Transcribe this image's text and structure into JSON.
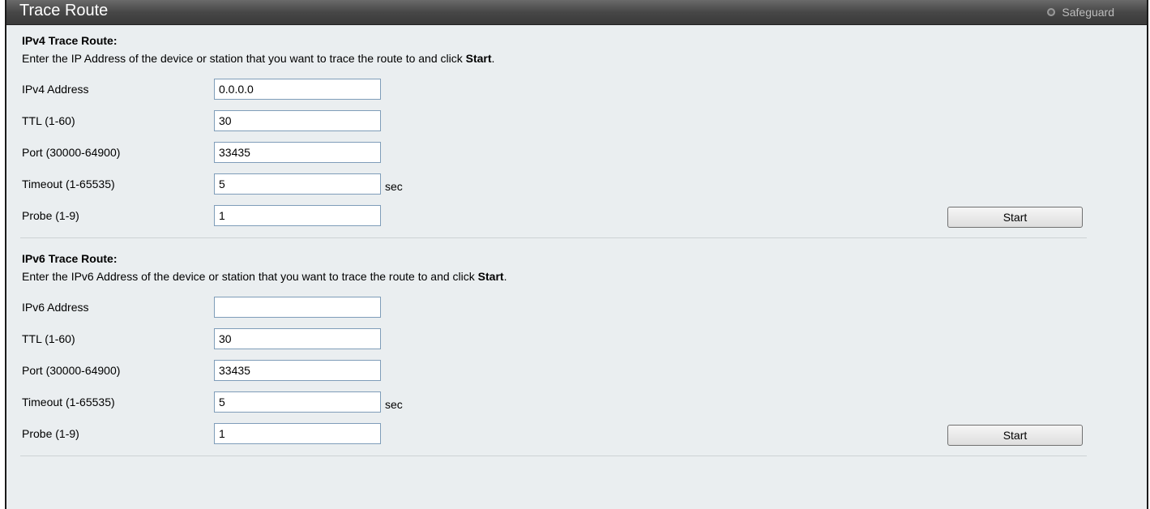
{
  "window": {
    "title": "Trace Route",
    "safeguard_label": "Safeguard"
  },
  "ipv4": {
    "heading": "IPv4 Trace Route:",
    "desc_prefix": "Enter the IP Address of the device or station that you want to trace the route to and click ",
    "desc_emphasis": "Start",
    "desc_suffix": ".",
    "address_label": "IPv4 Address",
    "address_value": "0.0.0.0",
    "ttl_label": "TTL (1-60)",
    "ttl_value": "30",
    "port_label": "Port (30000-64900)",
    "port_value": "33435",
    "timeout_label": "Timeout (1-65535)",
    "timeout_value": "5",
    "timeout_unit": "sec",
    "probe_label": "Probe (1-9)",
    "probe_value": "1",
    "start_label": "Start"
  },
  "ipv6": {
    "heading": "IPv6 Trace Route:",
    "desc_prefix": "Enter the IPv6 Address of the device or station that you want to trace the route to and click ",
    "desc_emphasis": "Start",
    "desc_suffix": ".",
    "address_label": "IPv6 Address",
    "address_value": "",
    "ttl_label": "TTL (1-60)",
    "ttl_value": "30",
    "port_label": "Port (30000-64900)",
    "port_value": "33435",
    "timeout_label": "Timeout (1-65535)",
    "timeout_value": "5",
    "timeout_unit": "sec",
    "probe_label": "Probe (1-9)",
    "probe_value": "1",
    "start_label": "Start"
  }
}
